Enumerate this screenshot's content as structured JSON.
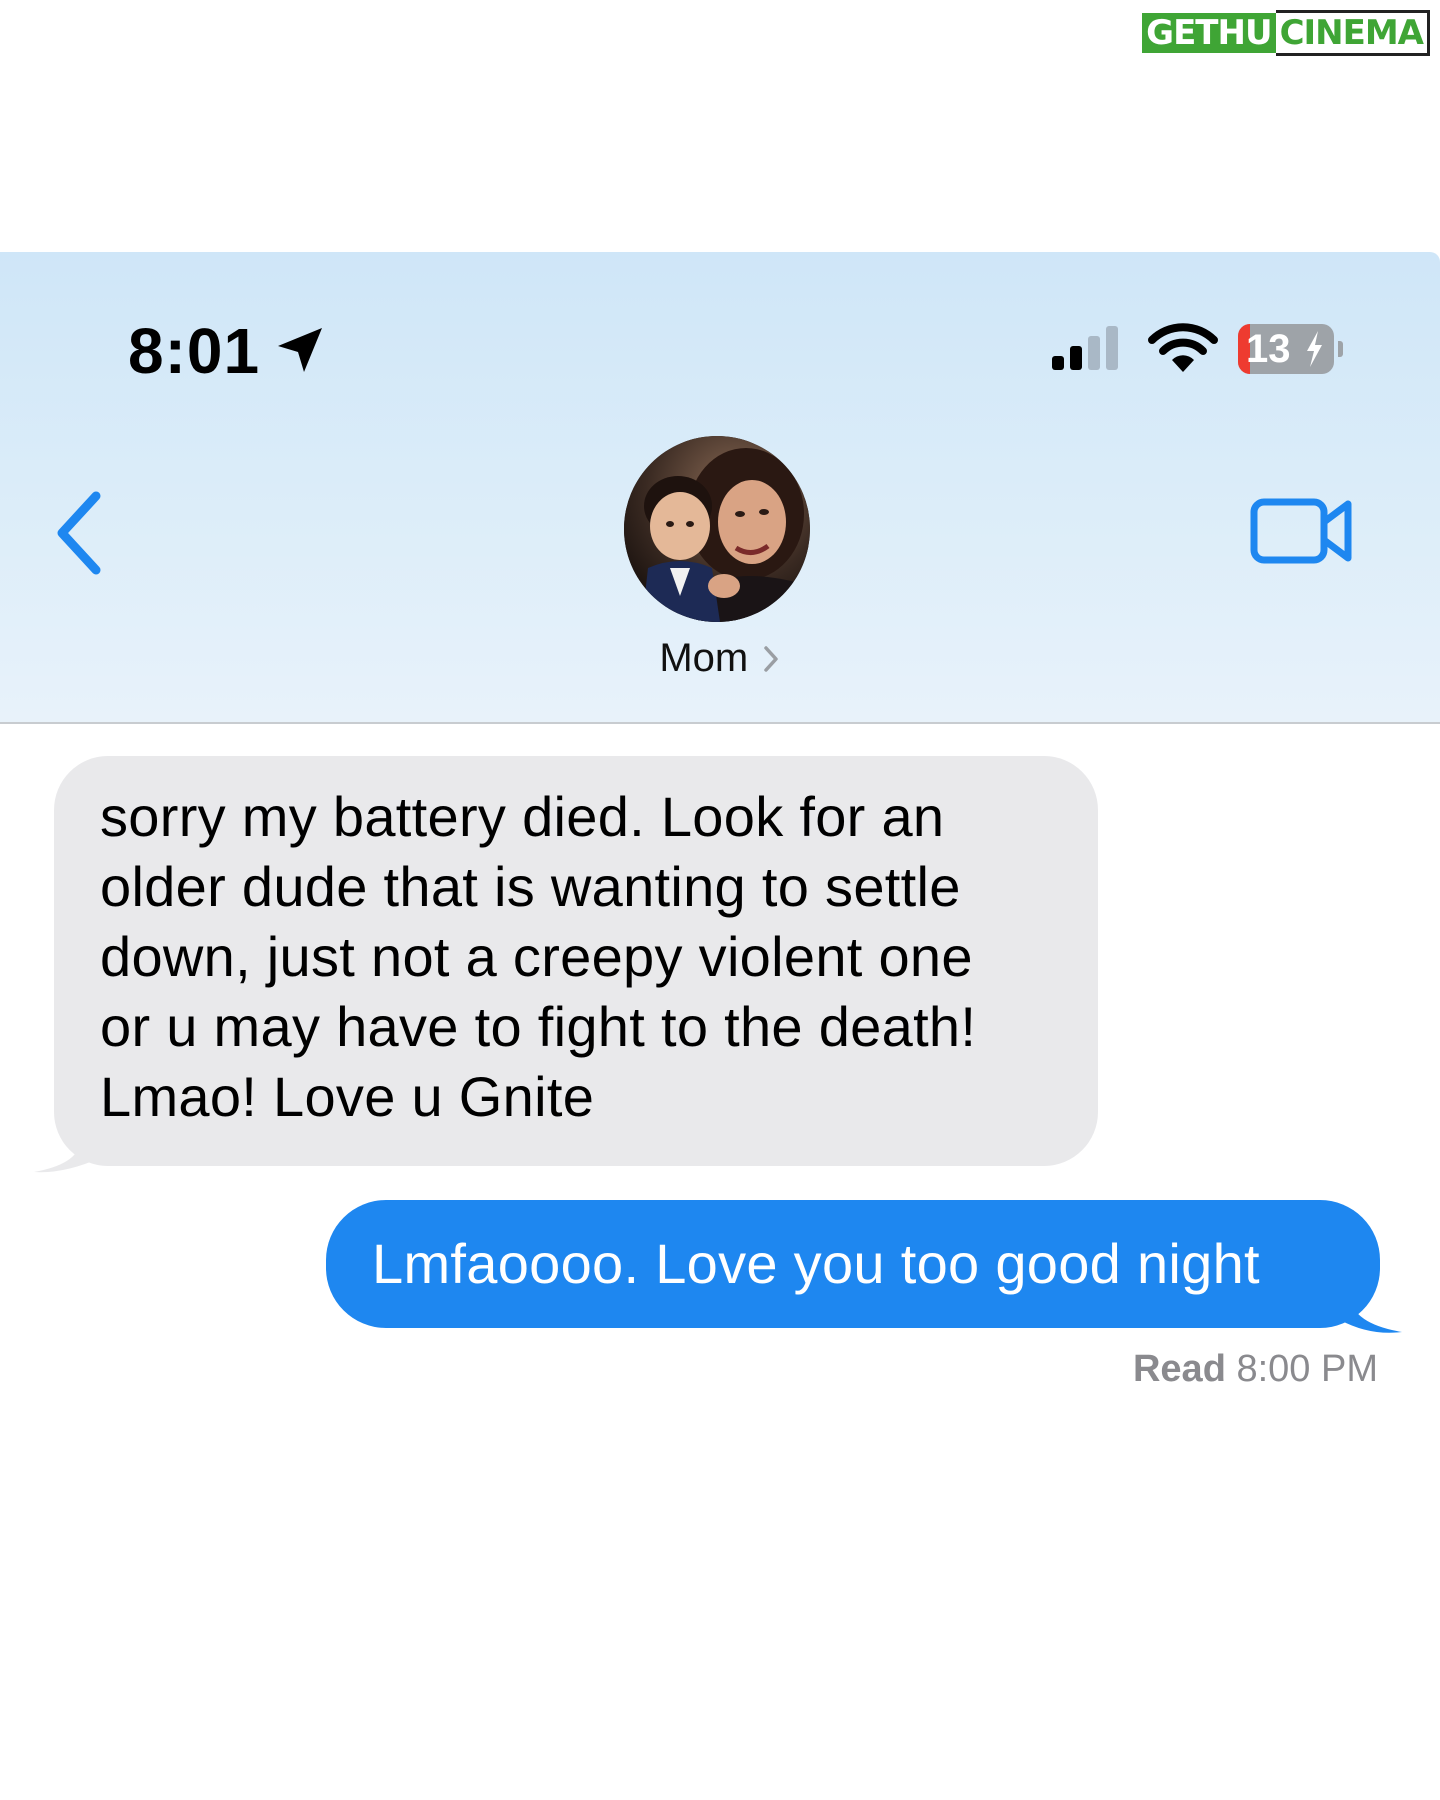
{
  "watermark": {
    "left": "GETHU",
    "right": "CINEMA"
  },
  "status_bar": {
    "time": "8:01",
    "battery_percent": "13",
    "battery_level": 0.13,
    "signal_bars_active": 2,
    "signal_bars_total": 4,
    "location_icon": "location-arrow-icon",
    "wifi_icon": "wifi-icon",
    "charging_icon": "bolt-icon"
  },
  "nav": {
    "back_icon": "chevron-left-icon",
    "contact_name": "Mom",
    "contact_chevron": "chevron-right-icon",
    "video_icon": "video-camera-icon"
  },
  "messages": [
    {
      "direction": "incoming",
      "text": "sorry my battery died. Look for an\nolder dude that is wanting to settle\ndown, just not a creepy violent one\nor u may have to fight to the death!\nLmao! Love u Gnite"
    },
    {
      "direction": "outgoing",
      "text": "Lmfaoooo. Love you too good night"
    }
  ],
  "read_receipt": {
    "label": "Read",
    "time": "8:00 PM"
  },
  "colors": {
    "accent": "#1e87f0",
    "incoming_bubble": "#e9e9eb",
    "battery_low": "#ee3b30",
    "watermark_green": "#3fa535"
  }
}
